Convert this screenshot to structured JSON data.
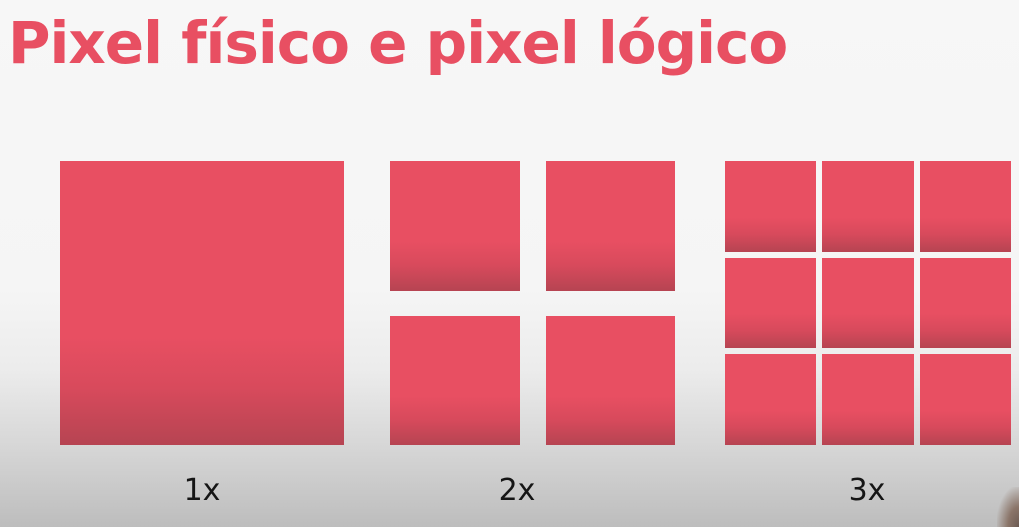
{
  "slide": {
    "title": "Pixel físico e pixel lógico",
    "title_color": "#e84f62",
    "pixel_color": "#e84f62",
    "label_color": "#151515",
    "groups": [
      {
        "label": "1x",
        "subdivisions": 1
      },
      {
        "label": "2x",
        "subdivisions": 2
      },
      {
        "label": "3x",
        "subdivisions": 3
      }
    ]
  }
}
